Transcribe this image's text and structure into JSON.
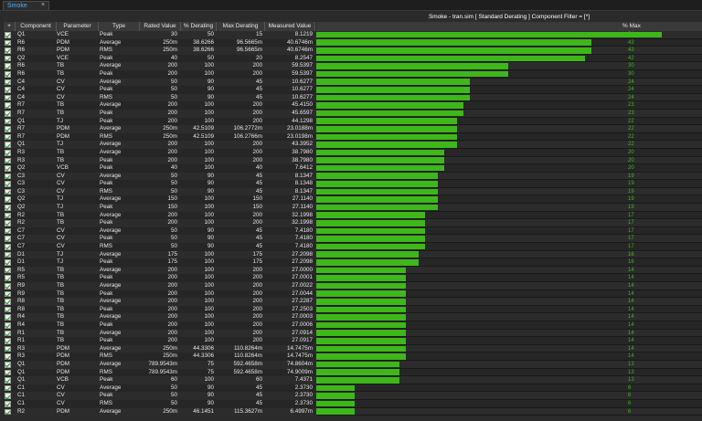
{
  "tab": {
    "label": "Smoke",
    "close": "×"
  },
  "chart_title": "Smoke - tran.sim  [ Standard Derating ] Component Filter = [*]",
  "columns": {
    "plus": "+",
    "component": "Component",
    "parameter": "Parameter",
    "type": "Type",
    "rated": "Rated Value",
    "derating": "% Derating",
    "max_derating": "Max Derating",
    "measured": "Measured Value",
    "pct_max": "% Max"
  },
  "colors": {
    "bar": "#3eb71a",
    "link": "#4ab0ff"
  },
  "rows": [
    {
      "component": "Q1",
      "parameter": "VCE",
      "type": "Peak",
      "rated": "30",
      "derating": "50",
      "max_derating": "15",
      "measured": "8.1219",
      "pct": 54
    },
    {
      "component": "R6",
      "parameter": "PDM",
      "type": "Average",
      "rated": "250m",
      "derating": "38.6266",
      "max_derating": "96.5665m",
      "measured": "40.6746m",
      "pct": 43
    },
    {
      "component": "R6",
      "parameter": "PDM",
      "type": "RMS",
      "rated": "250m",
      "derating": "38.6266",
      "max_derating": "96.5665m",
      "measured": "40.6746m",
      "pct": 43
    },
    {
      "component": "Q2",
      "parameter": "VCE",
      "type": "Peak",
      "rated": "40",
      "derating": "50",
      "max_derating": "20",
      "measured": "8.2547",
      "pct": 42
    },
    {
      "component": "R6",
      "parameter": "TB",
      "type": "Average",
      "rated": "200",
      "derating": "100",
      "max_derating": "200",
      "measured": "59.5397",
      "pct": 30
    },
    {
      "component": "R6",
      "parameter": "TB",
      "type": "Peak",
      "rated": "200",
      "derating": "100",
      "max_derating": "200",
      "measured": "59.5397",
      "pct": 30
    },
    {
      "component": "C4",
      "parameter": "CV",
      "type": "Average",
      "rated": "50",
      "derating": "90",
      "max_derating": "45",
      "measured": "10.6277",
      "pct": 24
    },
    {
      "component": "C4",
      "parameter": "CV",
      "type": "Peak",
      "rated": "50",
      "derating": "90",
      "max_derating": "45",
      "measured": "10.6277",
      "pct": 24
    },
    {
      "component": "C4",
      "parameter": "CV",
      "type": "RMS",
      "rated": "50",
      "derating": "90",
      "max_derating": "45",
      "measured": "10.6277",
      "pct": 24
    },
    {
      "component": "R7",
      "parameter": "TB",
      "type": "Average",
      "rated": "200",
      "derating": "100",
      "max_derating": "200",
      "measured": "45.4150",
      "pct": 23
    },
    {
      "component": "R7",
      "parameter": "TB",
      "type": "Peak",
      "rated": "200",
      "derating": "100",
      "max_derating": "200",
      "measured": "45.6597",
      "pct": 23
    },
    {
      "component": "Q1",
      "parameter": "TJ",
      "type": "Peak",
      "rated": "200",
      "derating": "100",
      "max_derating": "200",
      "measured": "44.1298",
      "pct": 22
    },
    {
      "component": "R7",
      "parameter": "PDM",
      "type": "Average",
      "rated": "250m",
      "derating": "42.5109",
      "max_derating": "106.2772m",
      "measured": "23.0188m",
      "pct": 22
    },
    {
      "component": "R7",
      "parameter": "PDM",
      "type": "RMS",
      "rated": "250m",
      "derating": "42.5109",
      "max_derating": "106.2766m",
      "measured": "23.0198m",
      "pct": 22
    },
    {
      "component": "Q1",
      "parameter": "TJ",
      "type": "Average",
      "rated": "200",
      "derating": "100",
      "max_derating": "200",
      "measured": "43.3952",
      "pct": 22
    },
    {
      "component": "R3",
      "parameter": "TB",
      "type": "Average",
      "rated": "200",
      "derating": "100",
      "max_derating": "200",
      "measured": "38.7980",
      "pct": 20
    },
    {
      "component": "R3",
      "parameter": "TB",
      "type": "Peak",
      "rated": "200",
      "derating": "100",
      "max_derating": "200",
      "measured": "38.7980",
      "pct": 20
    },
    {
      "component": "Q2",
      "parameter": "VCB",
      "type": "Peak",
      "rated": "40",
      "derating": "100",
      "max_derating": "40",
      "measured": "7.6412",
      "pct": 20
    },
    {
      "component": "C3",
      "parameter": "CV",
      "type": "Average",
      "rated": "50",
      "derating": "90",
      "max_derating": "45",
      "measured": "8.1347",
      "pct": 19
    },
    {
      "component": "C3",
      "parameter": "CV",
      "type": "Peak",
      "rated": "50",
      "derating": "90",
      "max_derating": "45",
      "measured": "8.1348",
      "pct": 19
    },
    {
      "component": "C3",
      "parameter": "CV",
      "type": "RMS",
      "rated": "50",
      "derating": "90",
      "max_derating": "45",
      "measured": "8.1347",
      "pct": 19
    },
    {
      "component": "Q2",
      "parameter": "TJ",
      "type": "Average",
      "rated": "150",
      "derating": "100",
      "max_derating": "150",
      "measured": "27.1140",
      "pct": 19
    },
    {
      "component": "Q2",
      "parameter": "TJ",
      "type": "Peak",
      "rated": "150",
      "derating": "100",
      "max_derating": "150",
      "measured": "27.1140",
      "pct": 19
    },
    {
      "component": "R2",
      "parameter": "TB",
      "type": "Average",
      "rated": "200",
      "derating": "100",
      "max_derating": "200",
      "measured": "32.1998",
      "pct": 17
    },
    {
      "component": "R2",
      "parameter": "TB",
      "type": "Peak",
      "rated": "200",
      "derating": "100",
      "max_derating": "200",
      "measured": "32.1998",
      "pct": 17
    },
    {
      "component": "C7",
      "parameter": "CV",
      "type": "Average",
      "rated": "50",
      "derating": "90",
      "max_derating": "45",
      "measured": "7.4180",
      "pct": 17
    },
    {
      "component": "C7",
      "parameter": "CV",
      "type": "Peak",
      "rated": "50",
      "derating": "90",
      "max_derating": "45",
      "measured": "7.4180",
      "pct": 17
    },
    {
      "component": "C7",
      "parameter": "CV",
      "type": "RMS",
      "rated": "50",
      "derating": "90",
      "max_derating": "45",
      "measured": "7.4180",
      "pct": 17
    },
    {
      "component": "D1",
      "parameter": "TJ",
      "type": "Average",
      "rated": "175",
      "derating": "100",
      "max_derating": "175",
      "measured": "27.2098",
      "pct": 16
    },
    {
      "component": "D1",
      "parameter": "TJ",
      "type": "Peak",
      "rated": "175",
      "derating": "100",
      "max_derating": "175",
      "measured": "27.2098",
      "pct": 16
    },
    {
      "component": "R5",
      "parameter": "TB",
      "type": "Average",
      "rated": "200",
      "derating": "100",
      "max_derating": "200",
      "measured": "27.0000",
      "pct": 14
    },
    {
      "component": "R5",
      "parameter": "TB",
      "type": "Peak",
      "rated": "200",
      "derating": "100",
      "max_derating": "200",
      "measured": "27.0001",
      "pct": 14
    },
    {
      "component": "R9",
      "parameter": "TB",
      "type": "Average",
      "rated": "200",
      "derating": "100",
      "max_derating": "200",
      "measured": "27.0022",
      "pct": 14
    },
    {
      "component": "R9",
      "parameter": "TB",
      "type": "Peak",
      "rated": "200",
      "derating": "100",
      "max_derating": "200",
      "measured": "27.0044",
      "pct": 14
    },
    {
      "component": "R8",
      "parameter": "TB",
      "type": "Average",
      "rated": "200",
      "derating": "100",
      "max_derating": "200",
      "measured": "27.2287",
      "pct": 14
    },
    {
      "component": "R8",
      "parameter": "TB",
      "type": "Peak",
      "rated": "200",
      "derating": "100",
      "max_derating": "200",
      "measured": "27.2503",
      "pct": 14
    },
    {
      "component": "R4",
      "parameter": "TB",
      "type": "Average",
      "rated": "200",
      "derating": "100",
      "max_derating": "200",
      "measured": "27.0003",
      "pct": 14
    },
    {
      "component": "R4",
      "parameter": "TB",
      "type": "Peak",
      "rated": "200",
      "derating": "100",
      "max_derating": "200",
      "measured": "27.0006",
      "pct": 14
    },
    {
      "component": "R1",
      "parameter": "TB",
      "type": "Average",
      "rated": "200",
      "derating": "100",
      "max_derating": "200",
      "measured": "27.0914",
      "pct": 14
    },
    {
      "component": "R1",
      "parameter": "TB",
      "type": "Peak",
      "rated": "200",
      "derating": "100",
      "max_derating": "200",
      "measured": "27.0917",
      "pct": 14
    },
    {
      "component": "R3",
      "parameter": "PDM",
      "type": "Average",
      "rated": "250m",
      "derating": "44.3306",
      "max_derating": "110.8264m",
      "measured": "14.7475m",
      "pct": 14
    },
    {
      "component": "R3",
      "parameter": "PDM",
      "type": "RMS",
      "rated": "250m",
      "derating": "44.3306",
      "max_derating": "110.8264m",
      "measured": "14.7475m",
      "pct": 14
    },
    {
      "component": "Q1",
      "parameter": "PDM",
      "type": "Average",
      "rated": "789.9543m",
      "derating": "75",
      "max_derating": "592.4658m",
      "measured": "74.8604m",
      "pct": 13
    },
    {
      "component": "Q1",
      "parameter": "PDM",
      "type": "RMS",
      "rated": "789.9543m",
      "derating": "75",
      "max_derating": "592.4658m",
      "measured": "74.9009m",
      "pct": 13
    },
    {
      "component": "Q1",
      "parameter": "VCB",
      "type": "Peak",
      "rated": "60",
      "derating": "100",
      "max_derating": "60",
      "measured": "7.4371",
      "pct": 13
    },
    {
      "component": "C1",
      "parameter": "CV",
      "type": "Average",
      "rated": "50",
      "derating": "90",
      "max_derating": "45",
      "measured": "2.3730",
      "pct": 6
    },
    {
      "component": "C1",
      "parameter": "CV",
      "type": "Peak",
      "rated": "50",
      "derating": "90",
      "max_derating": "45",
      "measured": "2.3730",
      "pct": 6
    },
    {
      "component": "C1",
      "parameter": "CV",
      "type": "RMS",
      "rated": "50",
      "derating": "90",
      "max_derating": "45",
      "measured": "2.3730",
      "pct": 6
    },
    {
      "component": "R2",
      "parameter": "PDM",
      "type": "Average",
      "rated": "250m",
      "derating": "46.1451",
      "max_derating": "115.3627m",
      "measured": "6.4997m",
      "pct": 6
    }
  ]
}
